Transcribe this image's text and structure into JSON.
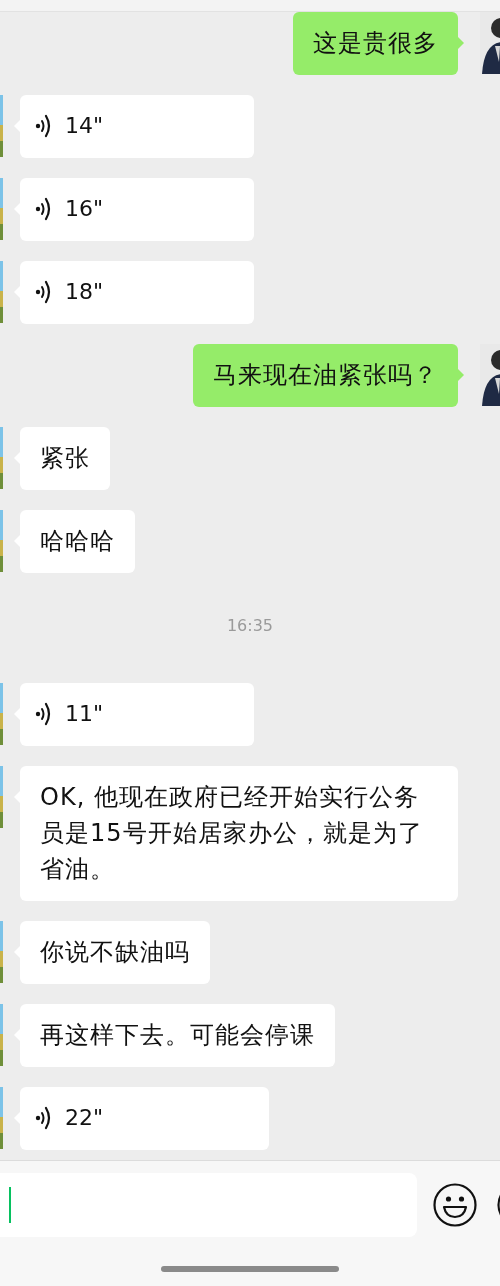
{
  "messages": [
    {
      "kind": "text",
      "outgoing": true,
      "text": "这是贵很多"
    },
    {
      "kind": "voice",
      "outgoing": false,
      "duration": "14\""
    },
    {
      "kind": "voice",
      "outgoing": false,
      "duration": "16\""
    },
    {
      "kind": "voice",
      "outgoing": false,
      "duration": "18\""
    },
    {
      "kind": "text",
      "outgoing": true,
      "text": "马来现在油紧张吗？"
    },
    {
      "kind": "text",
      "outgoing": false,
      "text": "紧张"
    },
    {
      "kind": "text",
      "outgoing": false,
      "text": "哈哈哈"
    },
    {
      "kind": "time",
      "text": "16:35"
    },
    {
      "kind": "voice",
      "outgoing": false,
      "duration": "11\""
    },
    {
      "kind": "text",
      "outgoing": false,
      "text": "OK, 他现在政府已经开始实行公务员是15号开始居家办公，就是为了省油。"
    },
    {
      "kind": "text",
      "outgoing": false,
      "text": "你说不缺油吗"
    },
    {
      "kind": "text",
      "outgoing": false,
      "text": "再这样下去。可能会停课"
    },
    {
      "kind": "voice",
      "outgoing": false,
      "duration": "22\""
    }
  ],
  "composer": {
    "focused": true
  }
}
